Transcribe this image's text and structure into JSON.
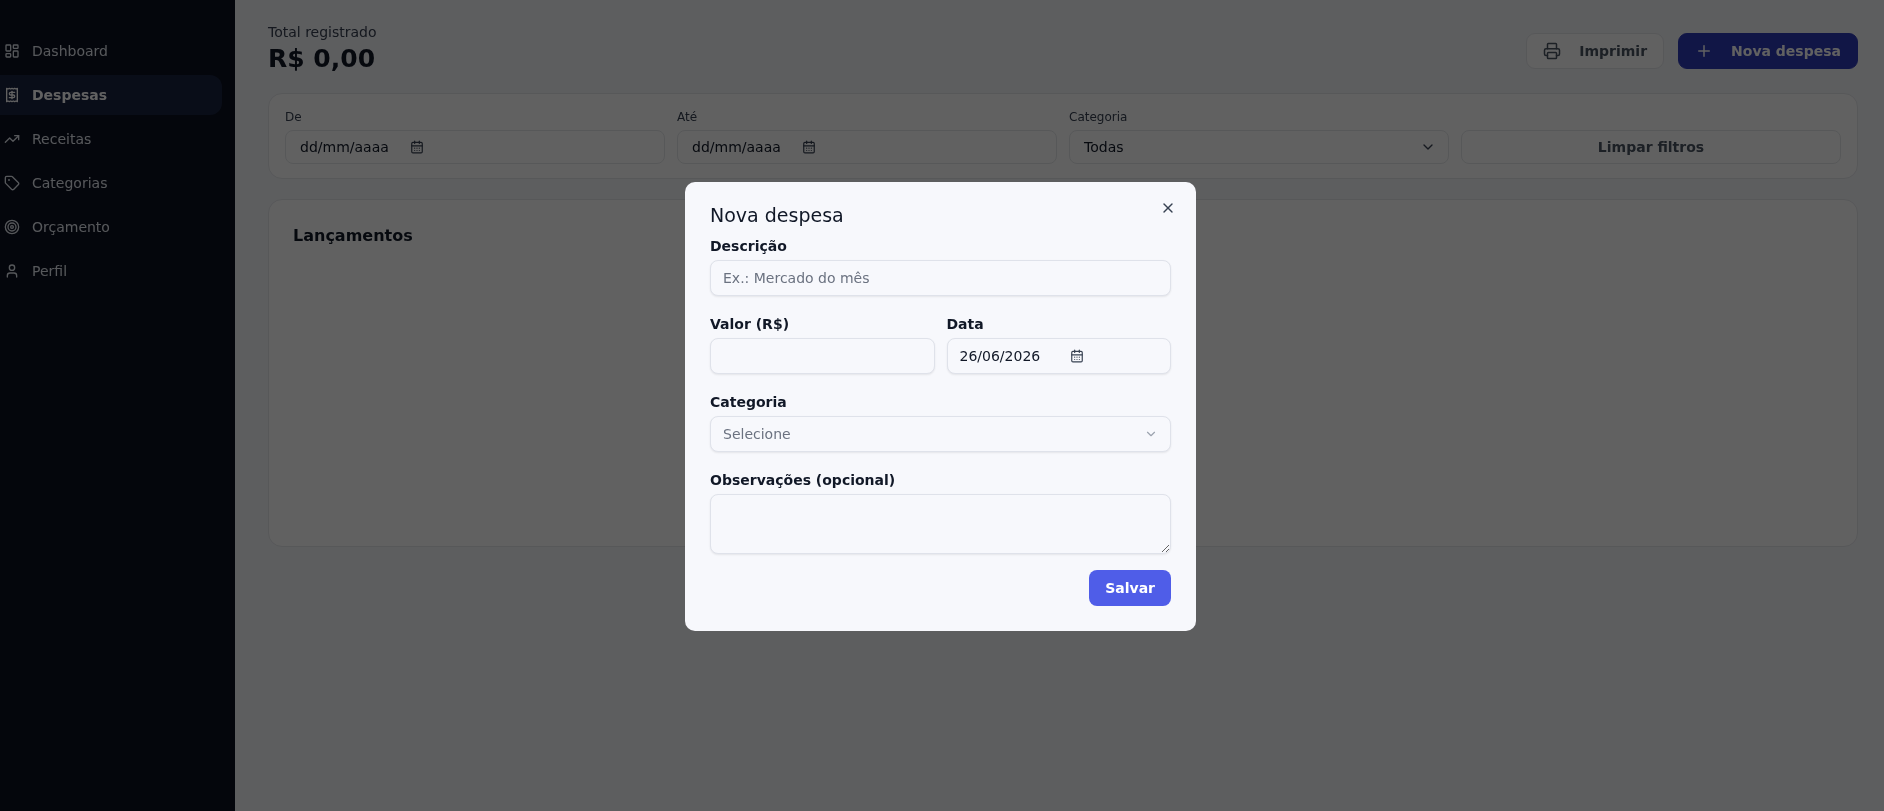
{
  "sidebar": {
    "items": [
      {
        "label": "Dashboard",
        "selected": false
      },
      {
        "label": "Despesas",
        "selected": true
      },
      {
        "label": "Receitas",
        "selected": false
      },
      {
        "label": "Categorias",
        "selected": false
      },
      {
        "label": "Orçamento",
        "selected": false
      },
      {
        "label": "Perfil",
        "selected": false
      }
    ]
  },
  "header": {
    "caption": "Total registrado",
    "total": "R$ 0,00",
    "actions": [
      {
        "kind": "secondary",
        "label": "Imprimir"
      },
      {
        "kind": "primary",
        "label": "Nova despesa"
      }
    ]
  },
  "filters": {
    "fields": [
      {
        "kind": "date",
        "label": "De",
        "placeholder": "dd/mm/aaaa"
      },
      {
        "kind": "date",
        "label": "Até",
        "placeholder": "dd/mm/aaaa"
      },
      {
        "kind": "select",
        "label": "Categoria",
        "value": "Todas"
      }
    ],
    "clear_button": "Limpar filtros"
  },
  "entries": {
    "title": "Lançamentos"
  },
  "modal": {
    "title": "Nova despesa",
    "rows": [
      [
        {
          "kind": "text",
          "label": "Descrição",
          "placeholder": "Ex.: Mercado do mês"
        }
      ],
      [
        {
          "kind": "text",
          "label": "Valor (R$)"
        },
        {
          "kind": "date",
          "label": "Data",
          "value": "26/06/2026"
        }
      ],
      [
        {
          "kind": "select",
          "label": "Categoria",
          "placeholder": "Selecione"
        }
      ],
      [
        {
          "kind": "textarea",
          "label": "Observações (opcional)"
        }
      ]
    ],
    "submit": "Salvar"
  }
}
